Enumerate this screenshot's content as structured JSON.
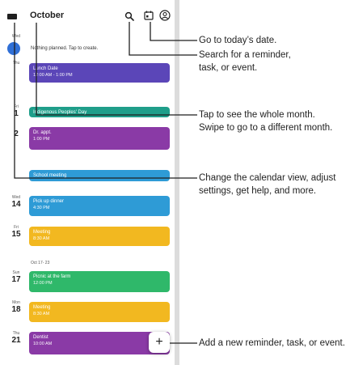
{
  "header": {
    "month_label": "October"
  },
  "today": {
    "dow": "Wed",
    "day": "11"
  },
  "empty_state": "Nothing planned. Tap to create.",
  "week_separator": "Oct 17- 23",
  "days": [
    {
      "dow": "Thu",
      "day": "12"
    },
    {
      "dow": "Fri",
      "day": "13"
    },
    {
      "dow": "Wed",
      "day": "14"
    },
    {
      "dow": "Fri",
      "day": "15"
    },
    {
      "dow": "Sun",
      "day": "17"
    },
    {
      "dow": "Mon",
      "day": "18"
    },
    {
      "dow": "Thu",
      "day": "21"
    }
  ],
  "events": [
    {
      "title": "Lunch Date",
      "time": "12:00 AM - 1:00 PM",
      "color": "#5b46b8"
    },
    {
      "title": "Indigenous Peoples' Day",
      "time": "",
      "color": "#1f9e8a"
    },
    {
      "title": "Dr. appt.",
      "time": "1:00 PM",
      "color": "#8a3aa6"
    },
    {
      "title": "School meeting",
      "time": "",
      "color": "#2e9bd6"
    },
    {
      "title": "Pick up dinner",
      "time": "4:30 PM",
      "color": "#2e9bd6"
    },
    {
      "title": "Meeting",
      "time": "8:30 AM",
      "color": "#f2b820"
    },
    {
      "title": "Picnic at the farm",
      "time": "12:00 PM",
      "color": "#2fb86a"
    },
    {
      "title": "Meeting",
      "time": "8:30 AM",
      "color": "#f2b820"
    },
    {
      "title": "Dentist",
      "time": "10:00 AM",
      "color": "#8a3aa6"
    }
  ],
  "fab_label": "+",
  "icons": {
    "menu": "menu-icon",
    "search": "search-icon",
    "today": "calendar-today-icon",
    "account": "account-icon",
    "add": "plus-icon"
  },
  "callouts": {
    "today": "Go to today’s date.",
    "search": "Search for a reminder, task, or event.",
    "month": "Tap to see the whole month. Swipe to go to a different month.",
    "menu": "Change the calendar view, adjust settings, get help, and more.",
    "add": "Add a new reminder, task, or event."
  }
}
